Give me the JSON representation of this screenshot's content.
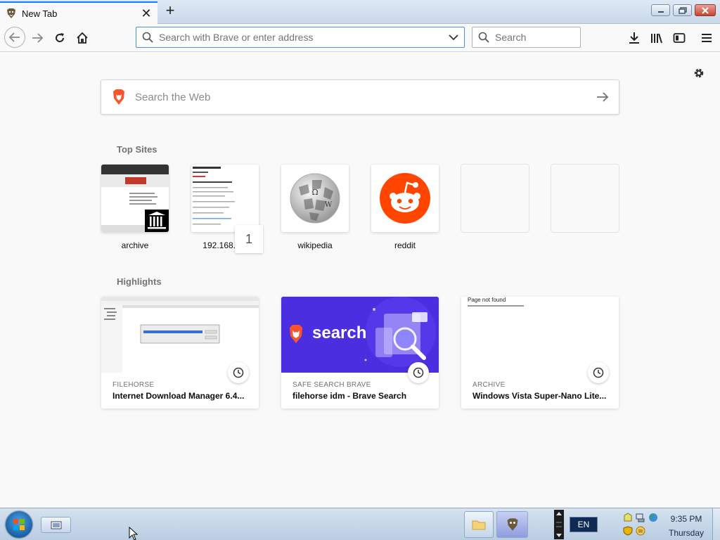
{
  "tab": {
    "title": "New Tab",
    "close": "✕"
  },
  "toolbar": {
    "new_tab": "+",
    "url_placeholder": "Search with Brave or enter address",
    "search_placeholder": "Search"
  },
  "content": {
    "web_search_placeholder": "Search the Web",
    "top_sites_title": "Top Sites",
    "top_sites": [
      {
        "label": "archive"
      },
      {
        "label": "192.168.1.1",
        "badge": "1"
      },
      {
        "label": "wikipedia"
      },
      {
        "label": "reddit"
      },
      {
        "label": ""
      },
      {
        "label": ""
      }
    ],
    "highlights_title": "Highlights",
    "highlights": [
      {
        "source": "FILEHORSE",
        "title": "Internet Download Manager 6.4..."
      },
      {
        "source": "SAFE SEARCH BRAVE",
        "title": "filehorse idm - Brave Search",
        "thumb_text": "search"
      },
      {
        "source": "ARCHIVE",
        "title": "Windows Vista Super-Nano Lite...",
        "thumb_text": "Page not found"
      }
    ]
  },
  "taskbar": {
    "language": "EN",
    "time": "9:35 PM",
    "day": "Thursday"
  },
  "colors": {
    "accent": "#0a84ff",
    "brave_orange": "#fb542b",
    "reddit_orange": "#ff4500",
    "brave_search_purple": "#4a2ee0"
  }
}
